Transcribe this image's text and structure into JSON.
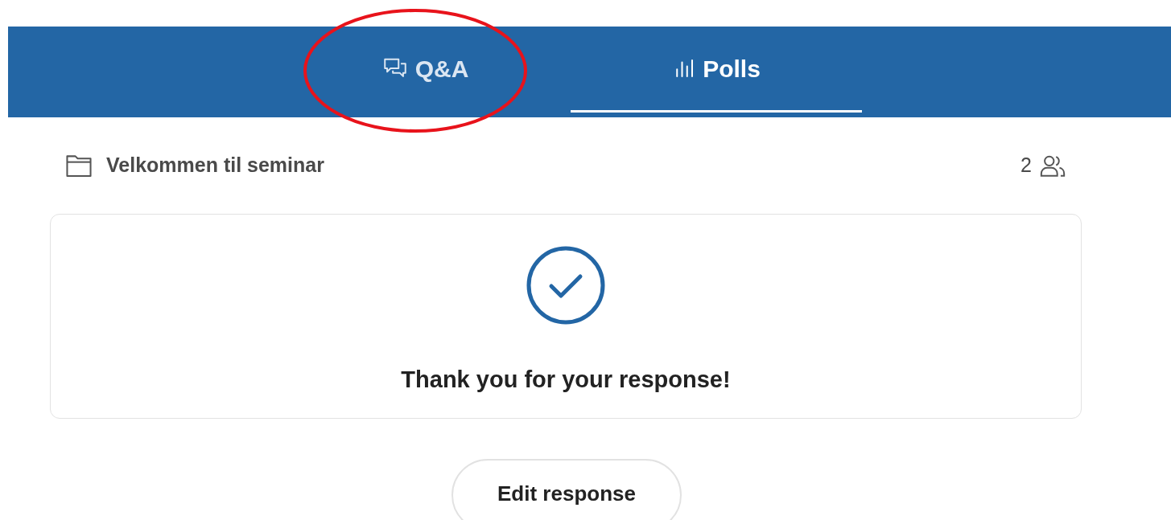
{
  "tabs": [
    {
      "kind": "qa",
      "label": "Q&A",
      "selected": false
    },
    {
      "kind": "polls",
      "label": "Polls",
      "selected": true
    }
  ],
  "session": {
    "title": "Velkommen til seminar",
    "participants": "2"
  },
  "confirmation": {
    "message": "Thank you for your response!"
  },
  "edit_button": "Edit response"
}
